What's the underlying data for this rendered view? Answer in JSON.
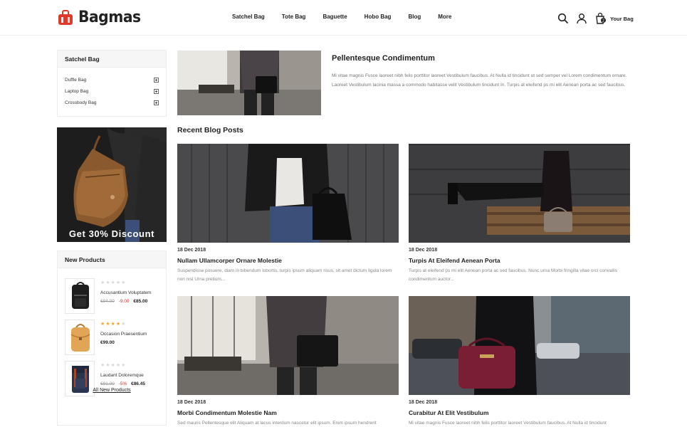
{
  "header": {
    "brand": "Bagmas",
    "nav": [
      "Satchel Bag",
      "Tote Bag",
      "Baguette",
      "Hobo Bag",
      "Blog",
      "More"
    ],
    "cart_count": "2",
    "cart_label": "Your Bag",
    "icons": [
      "search-icon",
      "user-icon",
      "cart-icon"
    ]
  },
  "sidebar": {
    "category_title": "Satchel Bag",
    "categories": [
      "Duffle Bag",
      "Laptop Bag",
      "Crossbody Bag"
    ],
    "promo_text": "Get 30% Discount",
    "new_products": {
      "title": "New Products",
      "items": [
        {
          "name": "Accusantium Voluptatem",
          "rating": 0,
          "old_price": "€94.00",
          "discount": "-9.00",
          "price": "€85.00"
        },
        {
          "name": "Occasion Praesentium",
          "rating": 4,
          "old_price": "",
          "discount": "",
          "price": "€99.00"
        },
        {
          "name": "Laudant Doloremque",
          "rating": 0,
          "old_price": "€91.00",
          "discount": "-5%",
          "price": "€86.45"
        }
      ],
      "all_link": "All New Products"
    }
  },
  "featured": {
    "title": "Pellentesque Condimentum",
    "text": "Mi vitae magnis Fusce laoreet nibh felis porttitor laoreet Vestibulum faucibus. At Nulla id tincidunt ut sed semper vel Lorem condimentum ornare. Laoreet Vestibulum lacinia massa a commodo habitasse velit Vestibulum tincidunt In. Turpis at eleifend ps mi elit Aenean porta ac sed faucibus."
  },
  "recent": {
    "title": "Recent Blog Posts",
    "posts": [
      {
        "date": "18 Dec 2018",
        "title": "Nullam Ullamcorper Ornare Molestie",
        "text": "Suspendisse posuere, diam in bibendum lobortis, turpis ipsum aliquam risus, sit amet dictum ligula lorem non nisl Urna pretium..."
      },
      {
        "date": "18 Dec 2018",
        "title": "Turpis At Eleifend Aenean Porta",
        "text": "Turpis at eleifend ps mi elit Aenean porta ac sed faucibus. Nunc urna Morbi fringilla vitae orci convallis condimentum auctor..."
      },
      {
        "date": "18 Dec 2018",
        "title": "Morbi Condimentum Molestie Nam",
        "text": "Sed mauris Pellentesque elit Aliquam at lacus interdum nascetur elit ipsum. Enim ipsum hendrerit"
      },
      {
        "date": "18 Dec 2018",
        "title": "Curabitur At Elit Vestibulum",
        "text": "Mi vitae magnis Fusce laoreet nibh felis porttitor laoreet Vestibulum faucibus. At Nulla id tincidunt"
      }
    ]
  },
  "colors": {
    "accent": "#e0382b",
    "star": "#f5a623",
    "star_empty": "#d8d8d8",
    "text": "#222222"
  }
}
